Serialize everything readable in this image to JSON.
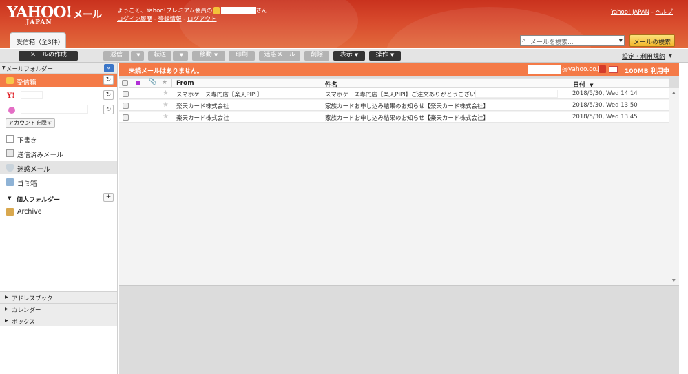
{
  "header": {
    "logo": {
      "brand": "YAHOO!",
      "product": "メール",
      "region": "JAPAN"
    },
    "welcome_prefix": "ようこそ、Yahoo!プレミアム会員の",
    "welcome_suffix": "さん",
    "links": [
      "ログイン履歴",
      "登録情報",
      "ログアウト"
    ],
    "top_links": [
      "Yahoo! JAPAN",
      "ヘルプ"
    ],
    "colors": {
      "header_red": "#d84a2c",
      "accent_orange": "#f47a47"
    }
  },
  "tab": {
    "label": "受信箱（全3件）"
  },
  "search": {
    "placeholder": "メールを検索...",
    "button": "メールの検索"
  },
  "toolbar": {
    "compose": "メールの作成",
    "reply": "返信",
    "forward": "転送",
    "move": "移動",
    "print": "印刷",
    "spam": "迷惑メール",
    "delete": "削除",
    "view": "表示",
    "actions": "操作",
    "settings": "設定・利用規約"
  },
  "sidebar": {
    "folder_header": "メールフォルダー",
    "inbox": "受信箱",
    "hide_accounts": "アカウントを隠す",
    "drafts": "下書き",
    "sent": "送信済みメール",
    "spam": "迷惑メール",
    "trash": "ゴミ箱",
    "personal_header": "個人フォルダー",
    "personal_folders": [
      "Archive"
    ],
    "sections": [
      "アドレスブック",
      "カレンダー",
      "ボックス"
    ]
  },
  "notice": {
    "text": "未読メールはありません。",
    "address_domain": "@yahoo.co.jp",
    "quota": "100MB 利用中"
  },
  "columns": {
    "from": "From",
    "subject": "件名",
    "date": "日付"
  },
  "messages": [
    {
      "from": "スマホケース専門店【楽天PIPI】",
      "subject": "スマホケース専門店【楽天PIPI】ご注文ありがとうございます。",
      "date": "2018/5/30, Wed 14:14"
    },
    {
      "from": "楽天カード株式会社",
      "subject": "家族カードお申し込み結果のお知らせ【楽天カード株式会社】",
      "date": "2018/5/30, Wed 13:50"
    },
    {
      "from": "楽天カード株式会社",
      "subject": "家族カードお申し込み結果のお知らせ【楽天カード株式会社】",
      "date": "2018/5/30, Wed 13:45"
    }
  ]
}
